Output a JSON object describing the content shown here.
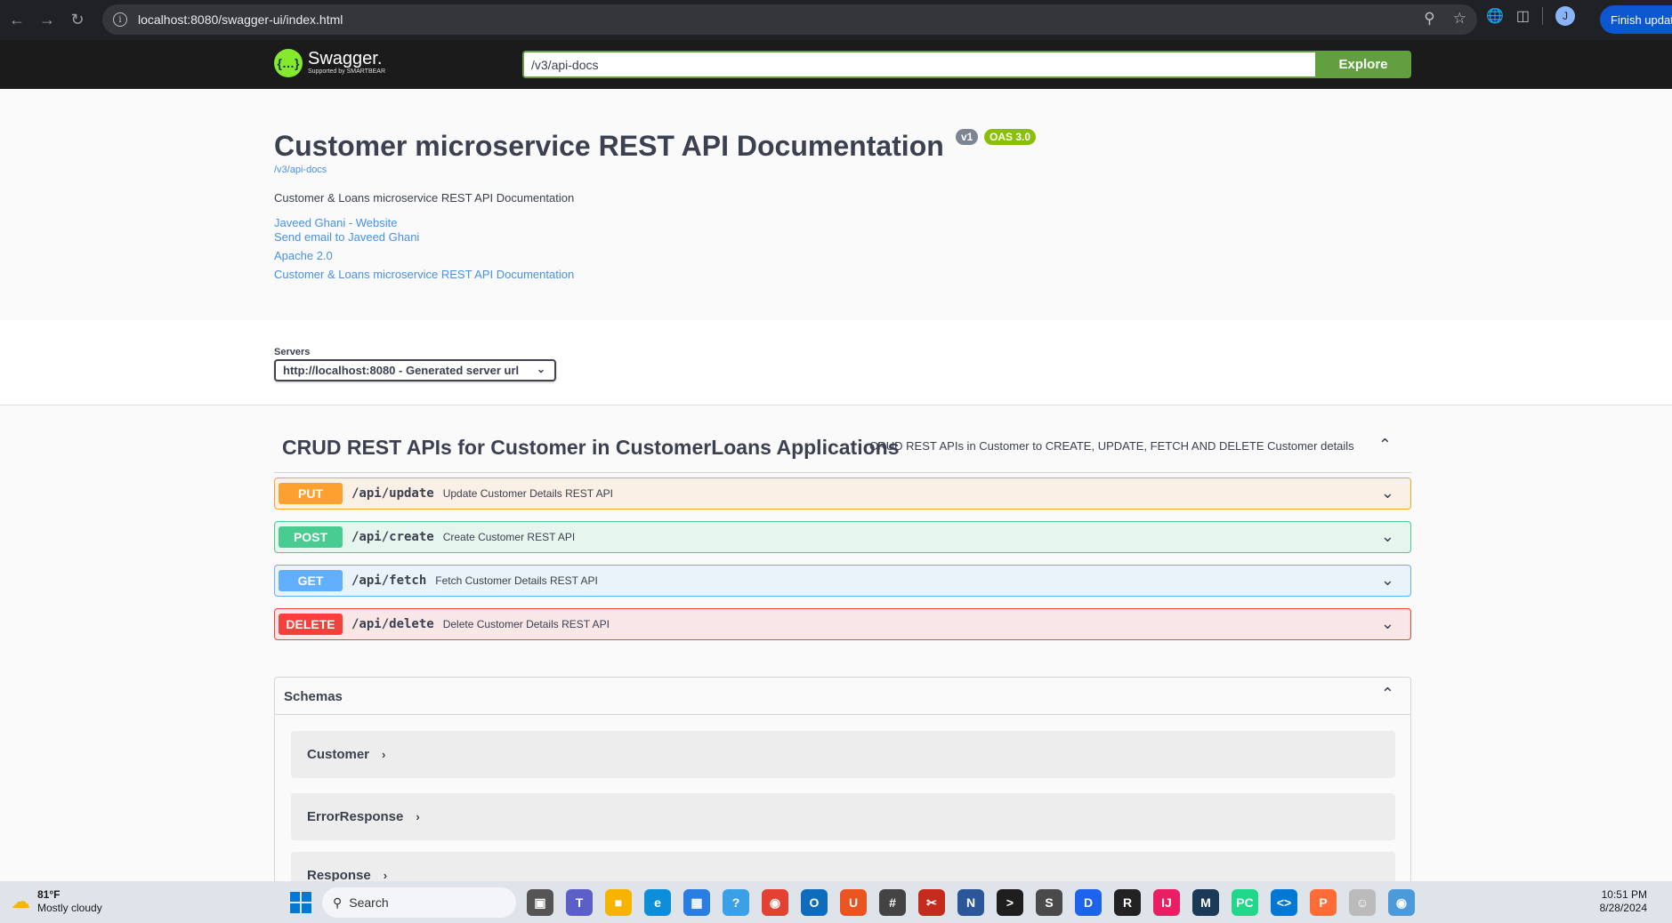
{
  "browser": {
    "url": "localhost:8080/swagger-ui/index.html",
    "profile_initial": "J",
    "finish_update_label": "Finish update"
  },
  "topbar": {
    "logo_text": "Swagger.",
    "logo_sub": "Supported by SMARTBEAR",
    "spec_url": "/v3/api-docs",
    "explore_label": "Explore"
  },
  "info": {
    "title": "Customer microservice REST API Documentation",
    "version_badge": "v1",
    "oas_badge": "OAS 3.0",
    "spec_link": "/v3/api-docs",
    "description": "Customer & Loans microservice REST API Documentation",
    "links": [
      "Javeed Ghani - Website",
      "Send email to Javeed Ghani",
      "Apache 2.0",
      "Customer & Loans microservice REST API Documentation"
    ]
  },
  "servers": {
    "label": "Servers",
    "selected": "http://localhost:8080 - Generated server url"
  },
  "tag": {
    "name": "CRUD REST APIs for Customer in CustomerLoans Applications",
    "description": "CRUD REST APIs in Customer to CREATE, UPDATE, FETCH AND DELETE Customer details"
  },
  "operations": [
    {
      "method": "PUT",
      "path": "/api/update",
      "summary": "Update Customer Details REST API"
    },
    {
      "method": "POST",
      "path": "/api/create",
      "summary": "Create Customer REST API"
    },
    {
      "method": "GET",
      "path": "/api/fetch",
      "summary": "Fetch Customer Details REST API"
    },
    {
      "method": "DELETE",
      "path": "/api/delete",
      "summary": "Delete Customer Details REST API"
    }
  ],
  "schemas": {
    "title": "Schemas",
    "models": [
      "Customer",
      "ErrorResponse",
      "Response"
    ]
  },
  "taskbar": {
    "temperature": "81°F",
    "weather": "Mostly cloudy",
    "search_label": "Search",
    "time": "10:51 PM",
    "date": "8/28/2024"
  },
  "colors": {
    "put": "#fca130",
    "post": "#49cc90",
    "get": "#61affe",
    "delete": "#f93e3e",
    "explore": "#62a03f"
  }
}
